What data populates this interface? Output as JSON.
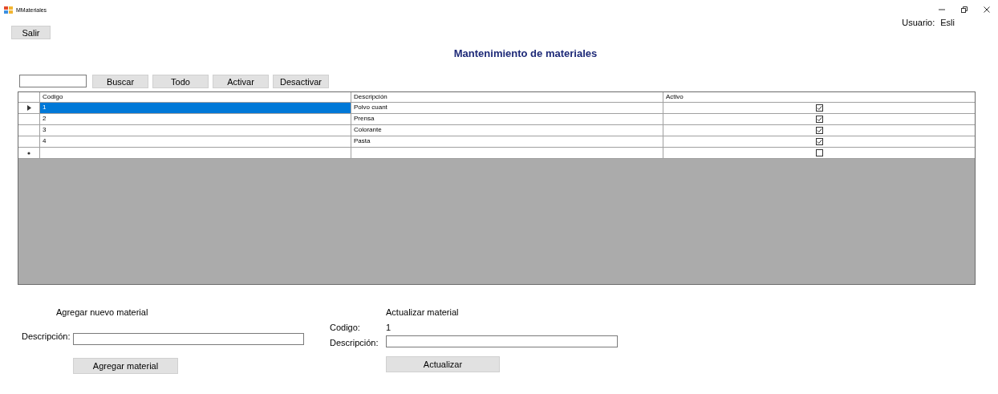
{
  "window": {
    "title": "MMateriales"
  },
  "exit_button": "Salir",
  "user": {
    "label": "Usuario:",
    "name": "Esli"
  },
  "heading": "Mantenimiento de materiales",
  "toolbar": [
    "Buscar",
    "Todo",
    "Activar",
    "Desactivar"
  ],
  "table": {
    "columns": [
      "Codigo",
      "Descripción",
      "Activo"
    ],
    "rows": [
      {
        "kind": "data",
        "codigo": "1",
        "descripcion": "Polvo cuant",
        "activo": true,
        "selected": true
      },
      {
        "kind": "data",
        "codigo": "2",
        "descripcion": "Prensa",
        "activo": true,
        "selected": false
      },
      {
        "kind": "data",
        "codigo": "3",
        "descripcion": "Colorante",
        "activo": true,
        "selected": false
      },
      {
        "kind": "data",
        "codigo": "4",
        "descripcion": "Pasta",
        "activo": true,
        "selected": false
      },
      {
        "kind": "new",
        "codigo": "",
        "descripcion": "",
        "activo": false,
        "selected": false
      }
    ]
  },
  "add_form": {
    "title": "Agregar nuevo material",
    "label": "Descripción:",
    "button": "Agregar material"
  },
  "update_form": {
    "title": "Actualizar material",
    "code_label": "Codigo:",
    "code_value": "1",
    "label": "Descripción:",
    "button": "Actualizar"
  }
}
